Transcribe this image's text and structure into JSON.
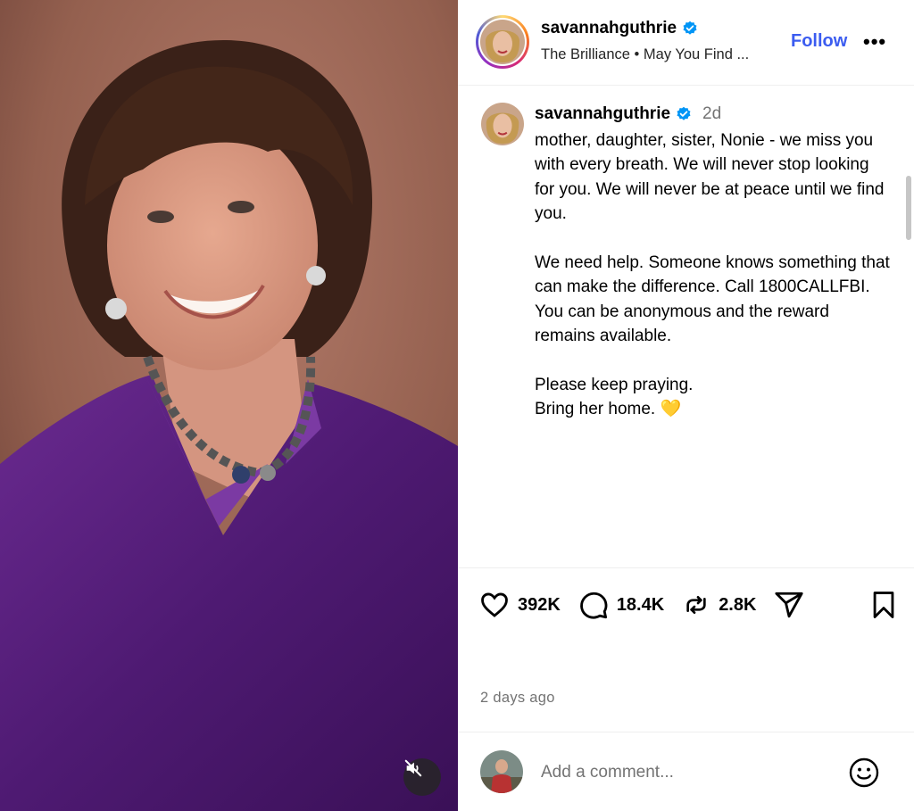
{
  "post": {
    "username": "savannahguthrie",
    "verified": true,
    "audio_line": "The Brilliance • May You Find ...",
    "follow_label": "Follow",
    "more_label": "•••",
    "time_short": "2d",
    "caption": [
      "mother, daughter, sister, Nonie - we miss you with every breath. We will never stop looking for you. We will never be at peace until we find you.",
      "We need help. Someone knows something that can make the difference. Call 1800CALLFBI. You can be anonymous and the reward remains available.",
      "Please keep praying.",
      "Bring her home. 💛"
    ],
    "likes": "392K",
    "comments": "18.4K",
    "reposts": "2.8K",
    "posted_ago": "2 days ago",
    "comment_placeholder": "Add a comment..."
  },
  "icons": {
    "verified": "verified-badge-icon",
    "like": "heart-icon",
    "comment": "comment-bubble-icon",
    "repost": "repost-icon",
    "share": "paper-plane-icon",
    "save": "bookmark-icon",
    "emoji": "emoji-icon",
    "mute": "speaker-muted-icon"
  },
  "colors": {
    "accent": "#3b5cf0",
    "verified": "#0095f6",
    "muted_text": "#737373",
    "shirt": "#5b1f7e"
  }
}
